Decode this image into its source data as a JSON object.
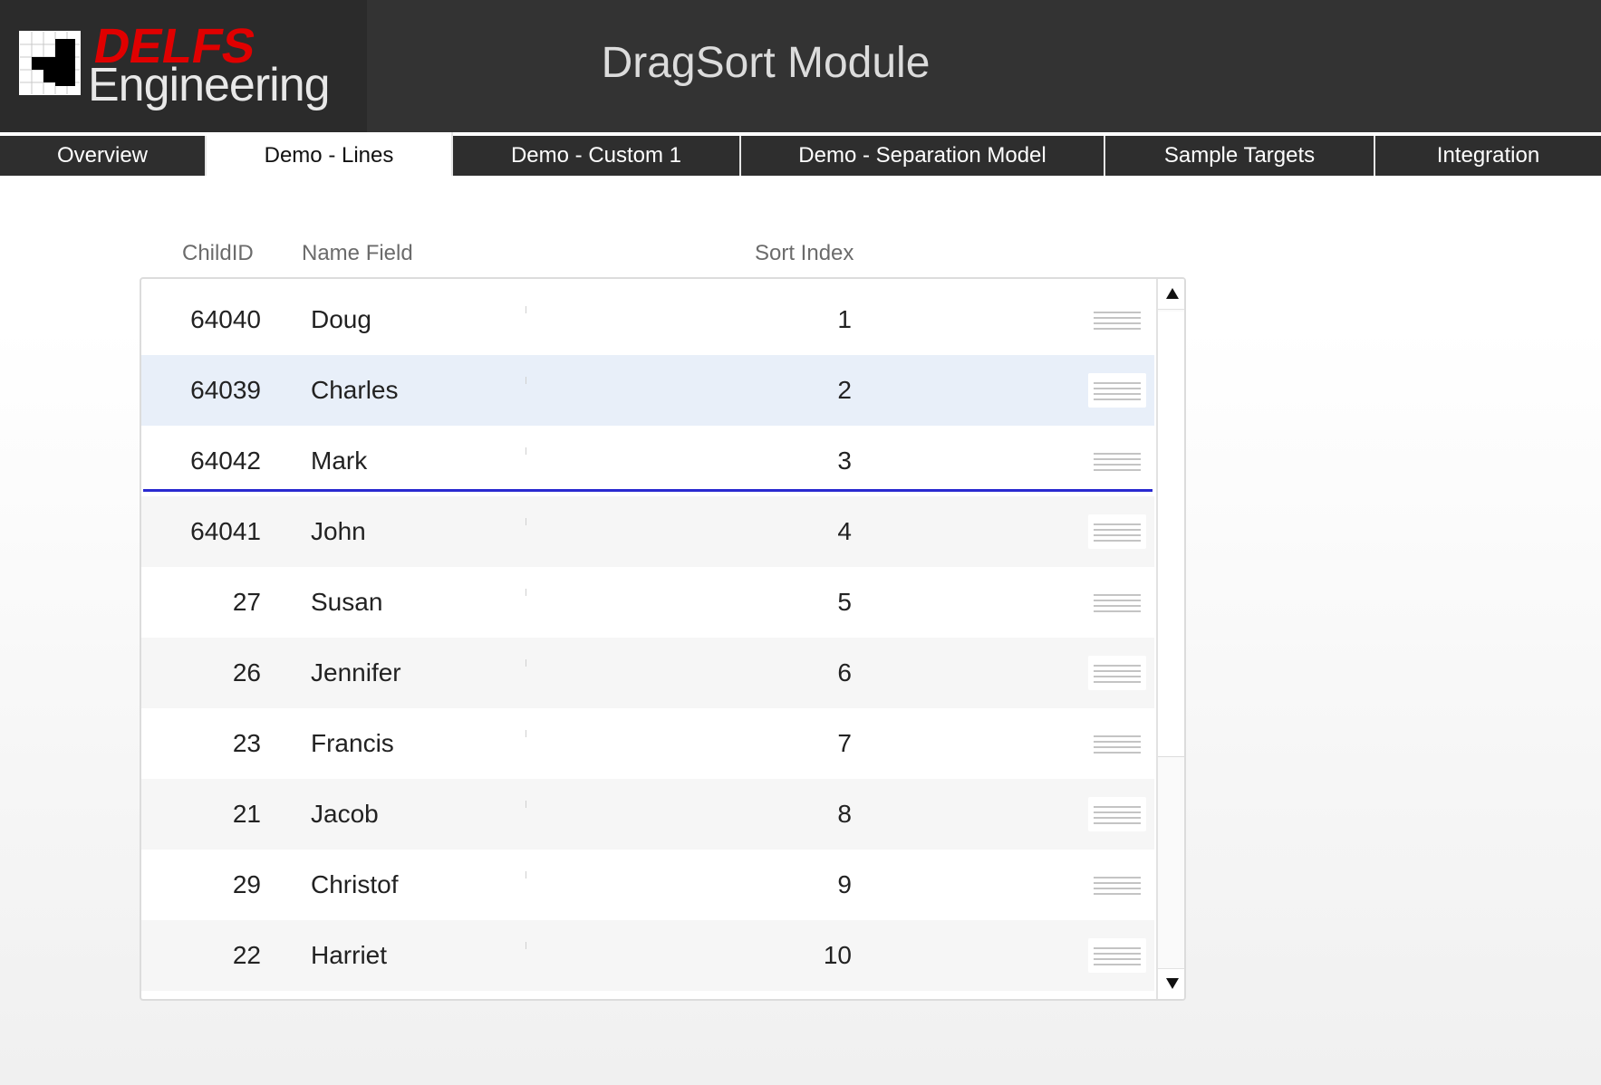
{
  "header": {
    "logo_word1": "DELFS",
    "logo_word2": "Engineering",
    "title": "DragSort Module"
  },
  "tabs": [
    {
      "label": "Overview",
      "active": false
    },
    {
      "label": "Demo - Lines",
      "active": true
    },
    {
      "label": "Demo - Custom 1",
      "active": false
    },
    {
      "label": "Demo - Separation Model",
      "active": false
    },
    {
      "label": "Sample Targets",
      "active": false
    },
    {
      "label": "Integration",
      "active": false
    }
  ],
  "grid": {
    "columns": {
      "child_id": "ChildID",
      "name": "Name Field",
      "sort_index": "Sort Index"
    },
    "rows": [
      {
        "child_id": "64040",
        "name": "Doug",
        "sort_index": "1"
      },
      {
        "child_id": "64039",
        "name": "Charles",
        "sort_index": "2"
      },
      {
        "child_id": "64042",
        "name": "Mark",
        "sort_index": "3"
      },
      {
        "child_id": "64041",
        "name": "John",
        "sort_index": "4"
      },
      {
        "child_id": "27",
        "name": "Susan",
        "sort_index": "5"
      },
      {
        "child_id": "26",
        "name": "Jennifer",
        "sort_index": "6"
      },
      {
        "child_id": "23",
        "name": "Francis",
        "sort_index": "7"
      },
      {
        "child_id": "21",
        "name": "Jacob",
        "sort_index": "8"
      },
      {
        "child_id": "29",
        "name": "Christof",
        "sort_index": "9"
      },
      {
        "child_id": "22",
        "name": "Harriet",
        "sort_index": "10"
      }
    ],
    "selected_row": 2,
    "drop_indicator_after_row": 3,
    "handle_icon": "drag-handle-icon",
    "colors": {
      "selected_row": "#e8eff9",
      "drop_line": "#2a2ad0",
      "alt_row": "#f6f6f6",
      "header_bg": "#333333",
      "brand_red": "#e00000"
    }
  },
  "scrollbar": {
    "up_icon": "arrow-up-icon",
    "down_icon": "arrow-down-icon"
  }
}
